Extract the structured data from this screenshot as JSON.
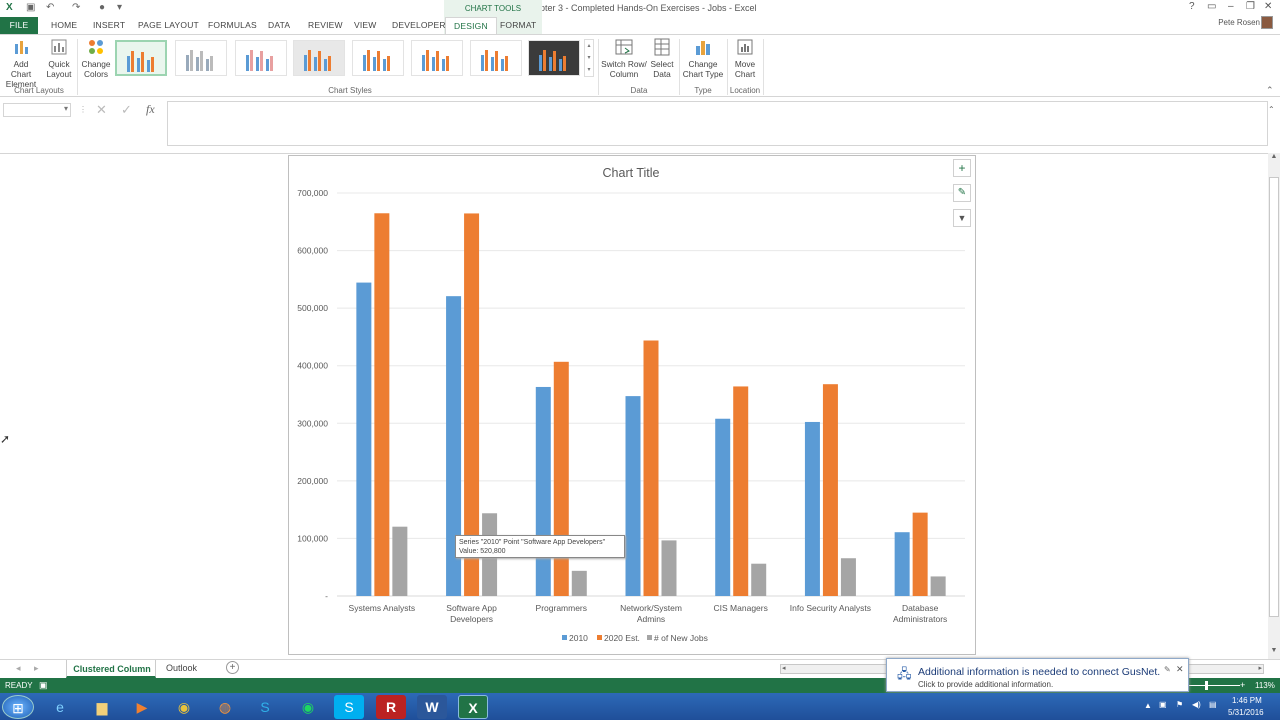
{
  "window": {
    "title": "Chapter 3 - Completed Hands-On Exercises - Jobs - Excel",
    "chart_tools": "CHART TOOLS",
    "user": "Pete Rosen"
  },
  "tabs": [
    "FILE",
    "HOME",
    "INSERT",
    "PAGE LAYOUT",
    "FORMULAS",
    "DATA",
    "REVIEW",
    "VIEW",
    "DEVELOPER",
    "DESIGN",
    "FORMAT"
  ],
  "ribbon": {
    "add_chart_element": [
      "Add Chart",
      "Element"
    ],
    "quick_layout": [
      "Quick",
      "Layout"
    ],
    "change_colors": [
      "Change",
      "Colors"
    ],
    "switch_row_column": [
      "Switch Row/",
      "Column"
    ],
    "select_data": [
      "Select",
      "Data"
    ],
    "change_chart_type": [
      "Change",
      "Chart Type"
    ],
    "move_chart": [
      "Move",
      "Chart"
    ],
    "groups": {
      "chart_layouts": "Chart Layouts",
      "chart_styles": "Chart Styles",
      "data": "Data",
      "type": "Type",
      "location": "Location"
    }
  },
  "formula_bar": {
    "fx": "fx"
  },
  "chart_data": {
    "type": "bar",
    "title": "Chart Title",
    "categories": [
      "Systems Analysts",
      "Software App Developers",
      "Programmers",
      "Network/System Admins",
      "CIS Managers",
      "Info Security Analysts",
      "Database Administrators"
    ],
    "category_lines": [
      [
        "Systems Analysts"
      ],
      [
        "Software App",
        "Developers"
      ],
      [
        "Programmers"
      ],
      [
        "Network/System",
        "Admins"
      ],
      [
        "CIS Managers"
      ],
      [
        "Info Security Analysts"
      ],
      [
        "Database",
        "Administrators"
      ]
    ],
    "series": [
      {
        "name": "2010",
        "color": "#5b9bd5",
        "values": [
          544400,
          520800,
          363100,
          347200,
          307900,
          302300,
          110800
        ]
      },
      {
        "name": "2020 Est.",
        "color": "#ed7d31",
        "values": [
          664800,
          664500,
          406800,
          443800,
          364000,
          367900,
          144800
        ]
      },
      {
        "name": "# of New Jobs",
        "color": "#a5a5a5",
        "values": [
          120400,
          143700,
          43700,
          96600,
          56100,
          65600,
          34000
        ]
      }
    ],
    "ylim": [
      0,
      700000
    ],
    "y_ticks": [
      "-",
      "100,000",
      "200,000",
      "300,000",
      "400,000",
      "500,000",
      "600,000",
      "700,000"
    ],
    "grid": true,
    "legend": "bottom",
    "tooltip": [
      "Series \"2010\" Point \"Software App Developers\"",
      "Value: 520,800"
    ]
  },
  "sheet_tabs": {
    "active": "Clustered Column",
    "other": "Outlook",
    "add": "+"
  },
  "status": {
    "ready": "READY",
    "zoom": "113%"
  },
  "notification": {
    "title": "Additional information is needed to connect GusNet.",
    "body": "Click to provide additional information."
  },
  "clock": {
    "time": "1:46 PM",
    "date": "5/31/2016"
  }
}
